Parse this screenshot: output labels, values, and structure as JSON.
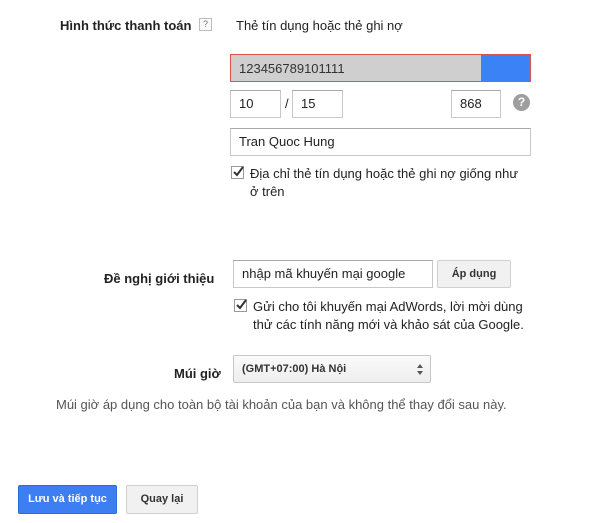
{
  "payment": {
    "label": "Hình thức thanh toán",
    "help": "?",
    "type": "Thẻ tín dụng hoặc thẻ ghi nợ",
    "card_number": "123456789101111",
    "exp_month": "10",
    "exp_sep": "/",
    "exp_year": "15",
    "cvv": "868",
    "cvv_help": "?",
    "name": "Tran Quoc Hung",
    "same_address_line1": "Địa chỉ thẻ tín dụng hoặc thẻ ghi nợ giống như",
    "same_address_line2": "ở trên",
    "same_address_checked": true
  },
  "promo": {
    "label": "Đề nghị giới thiệu",
    "code": "nhập mã khuyến mại google",
    "apply_label": "Áp dụng",
    "optin_line1": "Gửi cho tôi khuyến mại AdWords, lời mời dùng",
    "optin_line2": "thử các tính năng mới và khảo sát của Google.",
    "optin_checked": true
  },
  "timezone": {
    "label": "Múi giờ",
    "selected": "(GMT+07:00) Hà Nội",
    "note": "Múi giờ áp dụng cho toàn bộ tài khoản của bạn và không thể thay đổi sau này."
  },
  "actions": {
    "save_label": "Lưu và tiếp tục",
    "back_label": "Quay lại"
  },
  "colors": {
    "accent": "#3d7ef3",
    "card_swatch": "#3b82f6"
  }
}
